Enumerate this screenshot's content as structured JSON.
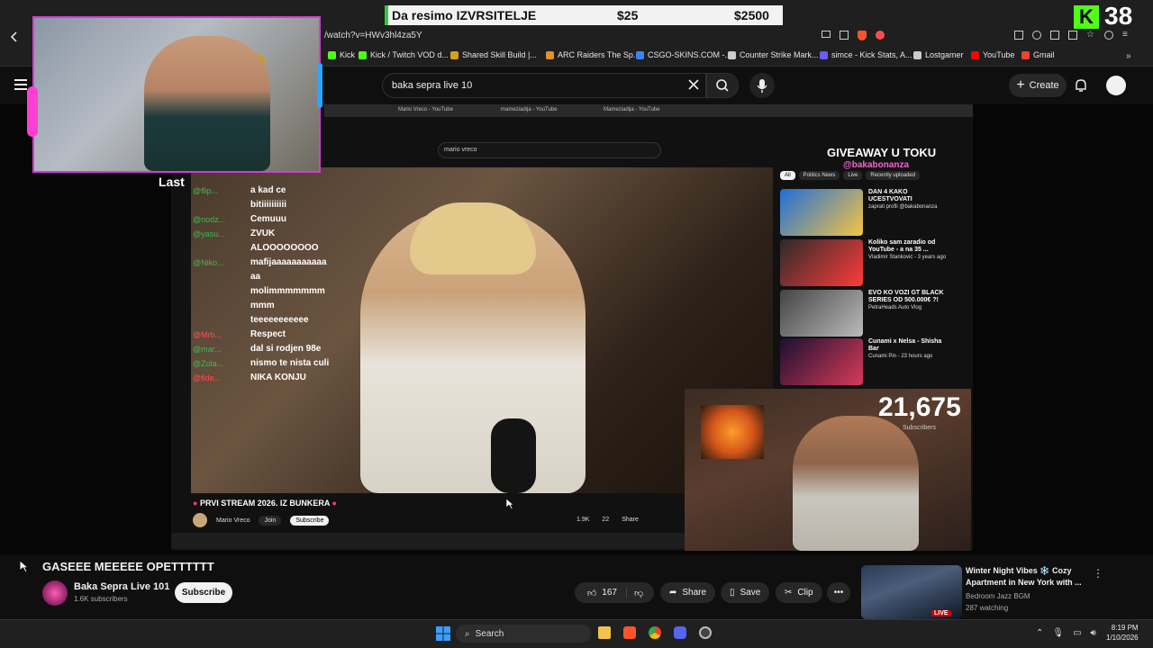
{
  "ticker": {
    "text": "Da resimo IZVRSITELJE",
    "amount1": "$25",
    "amount2": "$2500"
  },
  "kick": {
    "logo_letter": "K",
    "count": "38"
  },
  "browser": {
    "url": "/watch?v=HWv3hl4za5Y",
    "bookmarks": [
      {
        "label": "Kick",
        "color": "#53fc18"
      },
      {
        "label": "Kick / Twitch VOD d...",
        "color": "#53fc18"
      },
      {
        "label": "Shared Skill Build |...",
        "color": "#d4a017"
      },
      {
        "label": "ARC Raiders The Sp...",
        "color": "#e0922b"
      },
      {
        "label": "CSGO-SKINS.COM -...",
        "color": "#3b82f6"
      },
      {
        "label": "Counter Strike Mark...",
        "color": "#cccccc"
      },
      {
        "label": "simce - Kick Stats, A...",
        "color": "#6b5bff"
      },
      {
        "label": "Lostgamer",
        "color": "#cccccc"
      },
      {
        "label": "YouTube",
        "color": "#ff0000"
      },
      {
        "label": "Gmail",
        "color": "#ea4335"
      }
    ]
  },
  "yt": {
    "search_value": "baka sepra live 10",
    "create_label": "Create"
  },
  "overlay": {
    "last_label": "Last",
    "chat": [
      {
        "user": "@flip...",
        "msg": "a kad ce"
      },
      {
        "user": "",
        "msg": "bitiiiiiiiiii"
      },
      {
        "user": "@nodz...",
        "msg": "Cemuuu"
      },
      {
        "user": "@yasu...",
        "msg": "ZVUK"
      },
      {
        "user": "",
        "msg": "ALOOOOOOOO"
      },
      {
        "user": "@Niko...",
        "msg": "mafijaaaaaaaaaaa"
      },
      {
        "user": "",
        "msg": "aa"
      },
      {
        "user": "",
        "msg": "molimmmmmmm"
      },
      {
        "user": "",
        "msg": "mmm"
      },
      {
        "user": "",
        "msg": "teeeeeeeeeee"
      },
      {
        "user": "@Mrb...",
        "msg": "Respect"
      },
      {
        "user": "@mar...",
        "msg": "dal si rodjen 98e"
      },
      {
        "user": "@Zola...",
        "msg": "nismo te nista culi"
      },
      {
        "user": "@fide...",
        "msg": "NIKA KONJU"
      }
    ],
    "giveaway_title": "GIVEAWAY U TOKU",
    "giveaway_handle": "@bakabonanza",
    "sub_count": "21,675",
    "sub_count_label": "Subscribers"
  },
  "inner": {
    "search_value": "mario vreco",
    "tabs": [
      "Mario Vreco - YouTube",
      "mameziadija - YouTube",
      "Mameziadija - YouTube"
    ],
    "stream_title": "PRVI STREAM 2026. IZ BUNKERA",
    "channel": "Mario Vreco",
    "join": "Join",
    "subscribe": "Subscribe",
    "likes": "1.9K",
    "dislikes": "22",
    "share": "Share",
    "filters": [
      "All",
      "Politics News",
      "Live",
      "Recently uploaded"
    ],
    "related": [
      {
        "title": "DAN 4 KAKO UCESTVOVATI",
        "meta": "zaprati profil @bakabonanza"
      },
      {
        "title": "Koliko sam zaradio od YouTube - a na 35 ...",
        "meta": "Vladimir Stanković - 3 years ago"
      },
      {
        "title": "EVO KO VOZI GT BLACK SERIES OD 500.000€ ?!",
        "meta": "PetraHeads Auto Vlog"
      },
      {
        "title": "Cunami x Nelsa - Shisha Bar",
        "meta": "Cunami Pin - 23 hours ago"
      }
    ]
  },
  "video": {
    "title": "GASEEE MEEEEE OPETTTTTT",
    "channel": "Baka Sepra Live 101",
    "subs": "1.6K subscribers",
    "subscribe": "Subscribe",
    "likes": "167",
    "share": "Share",
    "save": "Save",
    "clip": "Clip"
  },
  "up_next": {
    "title": "Winter Night Vibes ❄️ Cozy Apartment in New York with ...",
    "channel": "Bedroom Jazz BGM",
    "watching": "287 watching",
    "badge": "LIVE"
  },
  "taskbar": {
    "search": "Search",
    "time": "8:19 PM",
    "date": "1/10/2026"
  }
}
